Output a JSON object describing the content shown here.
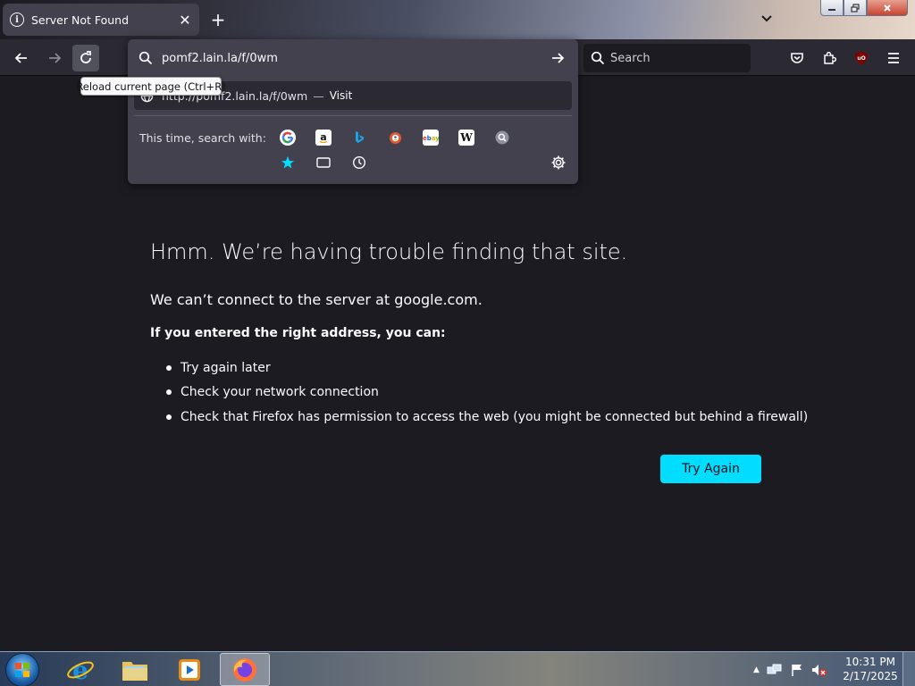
{
  "browser": {
    "tab_title": "Server Not Found",
    "new_tab_symbol": "+",
    "tab_close_symbol": "✕",
    "search_placeholder": "Search",
    "accent_color": "#00ddff"
  },
  "urlbar": {
    "value": "pomf2.lain.la/f/0wm",
    "result_url": "http://pomf2.lain.la/f/0wm",
    "result_separator": "—",
    "result_action": "Visit",
    "search_with_label": "This time, search with:",
    "engines": [
      "google-icon",
      "amazon-icon",
      "bing-icon",
      "duckduckgo-icon",
      "ebay-icon",
      "wikipedia-icon",
      "search-engine-icon"
    ],
    "modes": [
      "bookmarks-icon",
      "tabs-icon",
      "history-icon"
    ]
  },
  "tooltip": {
    "text": "Reload current page (Ctrl+R)"
  },
  "error_page": {
    "title": "Hmm. We’re having trouble finding that site.",
    "subtitle": "We can’t connect to the server at google.com.",
    "lead": "If you entered the right address, you can:",
    "suggestions": [
      "Try again later",
      "Check your network connection",
      "Check that Firefox has permission to access the web (you might be connected but behind a firewall)"
    ],
    "try_again_label": "Try Again"
  },
  "taskbar": {
    "time": "10:31 PM",
    "date": "2/17/2025",
    "tray_arrow": "▲"
  }
}
